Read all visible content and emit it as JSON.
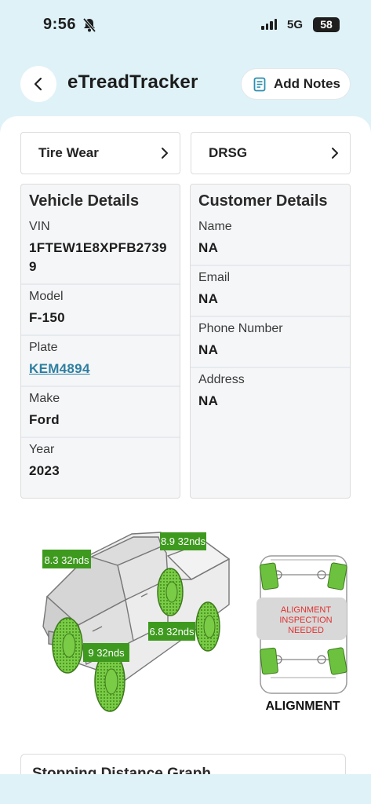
{
  "status": {
    "time": "9:56",
    "network": "5G",
    "battery": "58"
  },
  "header": {
    "title": "eTreadTracker",
    "add_notes_label": "Add Notes"
  },
  "nav": {
    "tire_wear": "Tire Wear",
    "drsg": "DRSG"
  },
  "vehicle": {
    "title": "Vehicle Details",
    "fields": [
      {
        "label": "VIN",
        "value": "1FTEW1E8XPFB27399"
      },
      {
        "label": "Model",
        "value": "F-150"
      },
      {
        "label": "Plate",
        "value": "KEM4894"
      },
      {
        "label": "Make",
        "value": "Ford"
      },
      {
        "label": "Year",
        "value": "2023"
      }
    ]
  },
  "customer": {
    "title": "Customer Details",
    "fields": [
      {
        "label": "Name",
        "value": "NA"
      },
      {
        "label": "Email",
        "value": "NA"
      },
      {
        "label": "Phone Number",
        "value": "NA"
      },
      {
        "label": "Address",
        "value": "NA"
      }
    ]
  },
  "tires": {
    "rear_right": "8.9 32nds",
    "front_right": "8.3 32nds",
    "rear_left": "6.8 32nds",
    "front_left": "9 32nds"
  },
  "alignment": {
    "warning": [
      "ALIGNMENT",
      "INSPECTION",
      "NEEDED"
    ],
    "label": "ALIGNMENT"
  },
  "stopping": {
    "title": "Stopping Distance Graph"
  },
  "colors": {
    "tire_green": "#6cc23e",
    "label_green": "#3e9a1e",
    "link": "#2d7fa0",
    "warning_text": "#e03030"
  }
}
